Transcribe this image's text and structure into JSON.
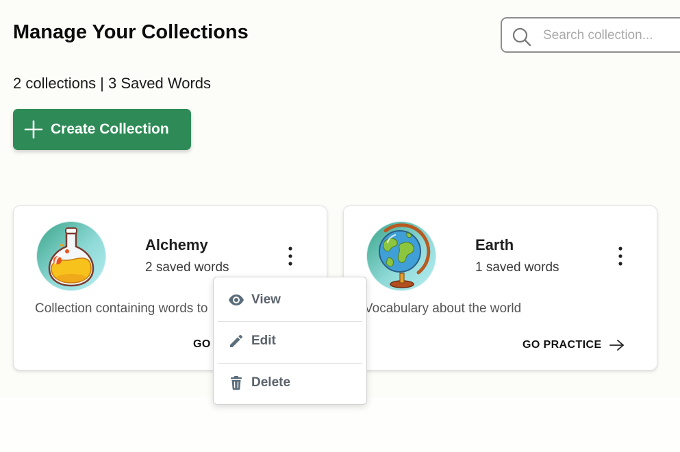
{
  "header": {
    "title": "Manage Your Collections"
  },
  "search": {
    "placeholder": "Search collection...",
    "icon": "search-icon"
  },
  "summary": "2 collections | 3 Saved Words",
  "create_button": {
    "label": "Create Collection",
    "icon": "plus-icon"
  },
  "colors": {
    "accent": "#2e8b57",
    "menu_text": "#5b636c",
    "background": "#fcfcf8"
  },
  "collections": [
    {
      "title": "Alchemy",
      "count": "2 saved words",
      "description": "Collection containing words to",
      "action": "GO",
      "icon": "potion-flask-icon"
    },
    {
      "title": "Earth",
      "count": "1 saved words",
      "description": "Vocabulary about the world",
      "action": "GO PRACTICE",
      "icon": "globe-icon"
    }
  ],
  "context_menu": {
    "items": [
      {
        "label": "View",
        "icon": "eye-icon"
      },
      {
        "label": "Edit",
        "icon": "pencil-icon"
      },
      {
        "label": "Delete",
        "icon": "trash-icon"
      }
    ]
  }
}
